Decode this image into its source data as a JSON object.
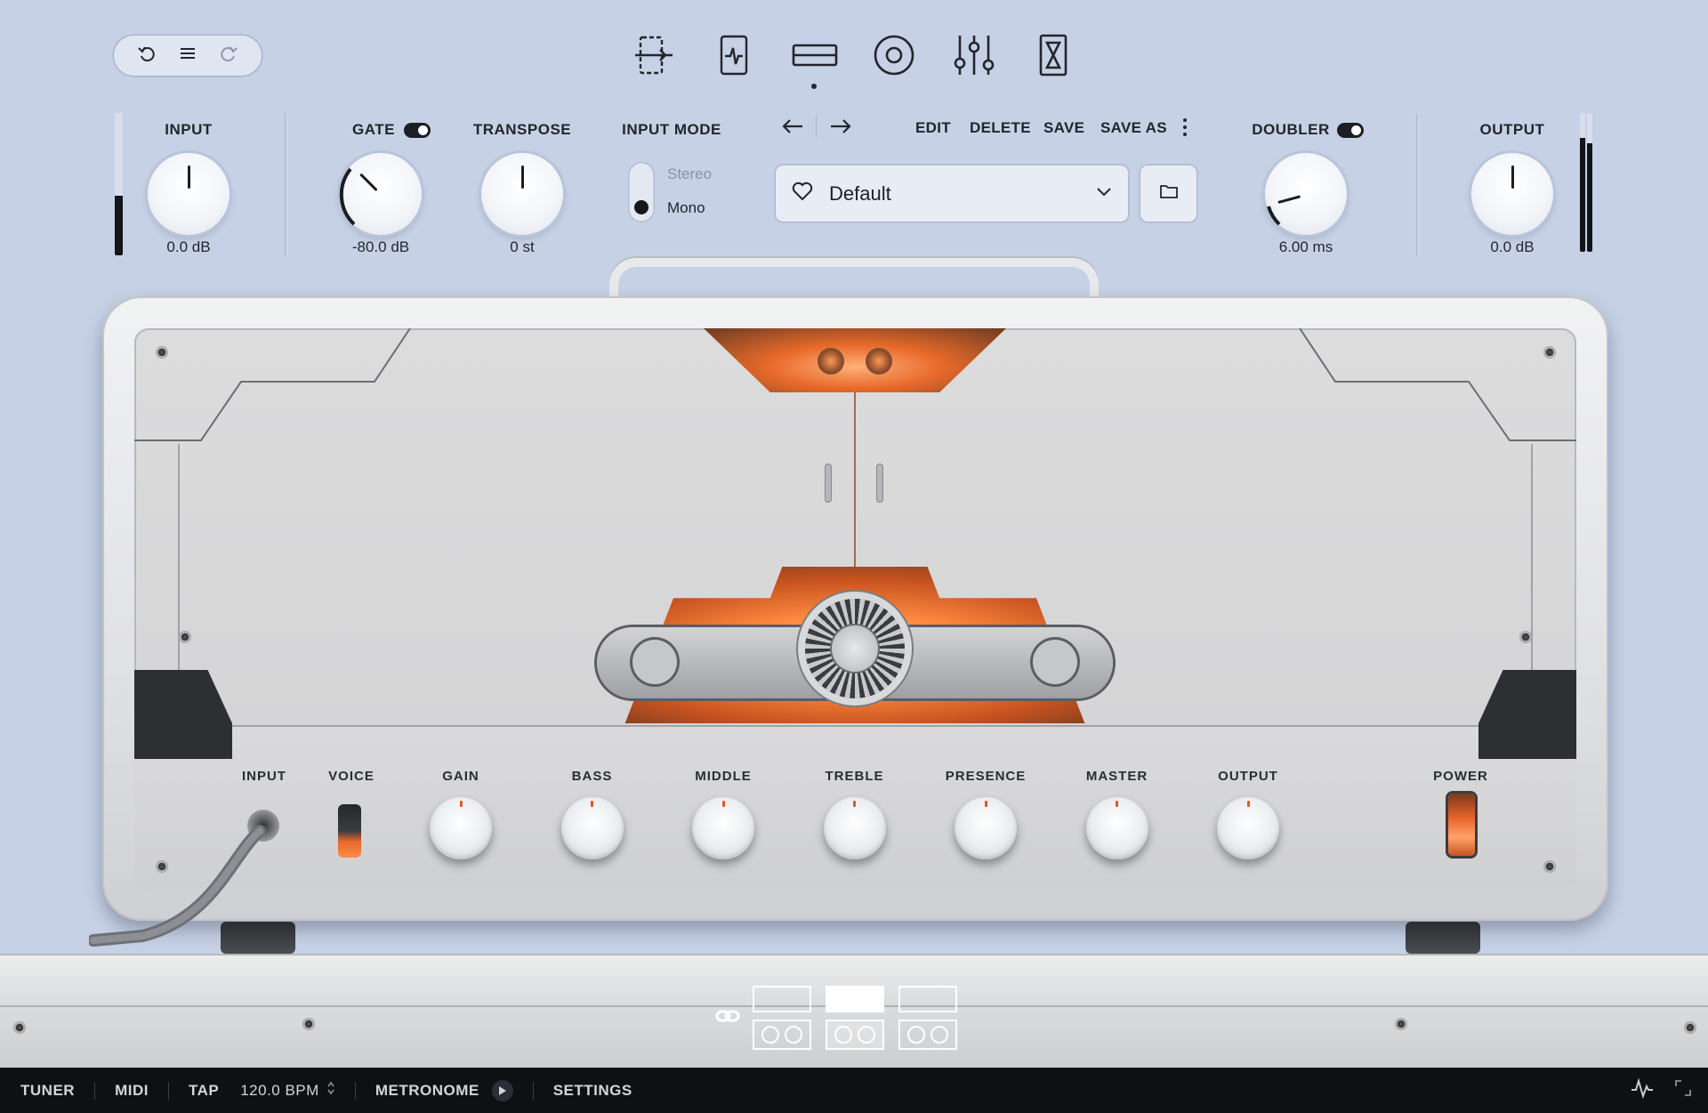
{
  "header": {
    "history": {
      "undo_icon": "undo-icon",
      "menu_icon": "menu-icon",
      "redo_icon": "redo-icon"
    },
    "nav_icons": [
      "input-processing-icon",
      "tuner-card-icon",
      "amp-rack-icon",
      "speaker-icon",
      "mixer-sliders-icon",
      "hourglass-icon"
    ],
    "active_nav_index": 2
  },
  "controls": {
    "input": {
      "label": "INPUT",
      "value": "0.0 dB",
      "meter_level": 0.42
    },
    "gate": {
      "label": "GATE",
      "value": "-80.0 dB",
      "enabled": true
    },
    "transpose": {
      "label": "TRANSPOSE",
      "value": "0 st"
    },
    "input_mode": {
      "label": "INPUT MODE",
      "options": [
        "Stereo",
        "Mono"
      ],
      "selected": "Mono"
    },
    "preset": {
      "back_icon": "arrow-left-icon",
      "forward_icon": "arrow-right-icon",
      "actions": [
        "EDIT",
        "DELETE",
        "SAVE",
        "SAVE AS"
      ],
      "more_icon": "more-vertical-icon",
      "name": "Default",
      "favorite_icon": "heart-icon",
      "dropdown_icon": "chevron-down-icon",
      "folder_icon": "folder-icon"
    },
    "doubler": {
      "label": "DOUBLER",
      "value": "6.00 ms",
      "enabled": true
    },
    "output": {
      "label": "OUTPUT",
      "value": "0.0 dB",
      "meter_levels": [
        0.82,
        0.78
      ]
    }
  },
  "amp": {
    "jack_labels": [
      "INPUT",
      "VOICE"
    ],
    "knobs": [
      "GAIN",
      "BASS",
      "MIDDLE",
      "TREBLE",
      "PRESENCE",
      "MASTER",
      "OUTPUT"
    ],
    "power_label": "POWER",
    "colors": {
      "accent": "#e8642a",
      "body": "#d9dadc",
      "glow": "#ff7a30"
    }
  },
  "rig_selector": {
    "link_icon": "link-icon",
    "heads": 3,
    "active_index": 1
  },
  "bottom_bar": {
    "tuner": "TUNER",
    "midi": "MIDI",
    "tap": "TAP",
    "bpm": "120.0 BPM",
    "metronome": "METRONOME",
    "settings": "SETTINGS",
    "activity_icon": "activity-icon",
    "resize_icon": "resize-icon"
  }
}
